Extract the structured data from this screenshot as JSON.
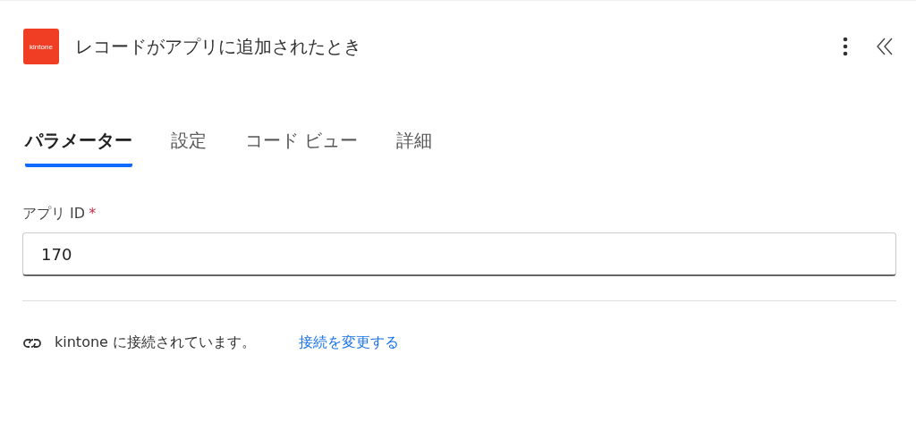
{
  "header": {
    "logo_text": "kintone",
    "title": "レコードがアプリに追加されたとき"
  },
  "tabs": [
    {
      "label": "パラメーター",
      "selected": true
    },
    {
      "label": "設定",
      "selected": false
    },
    {
      "label": "コード ビュー",
      "selected": false
    },
    {
      "label": "詳細",
      "selected": false
    }
  ],
  "field": {
    "label": "アプリ ID",
    "required_mark": "*",
    "value": "170"
  },
  "connection": {
    "status": "kintone に接続されています。",
    "link": "接続を変更する"
  }
}
